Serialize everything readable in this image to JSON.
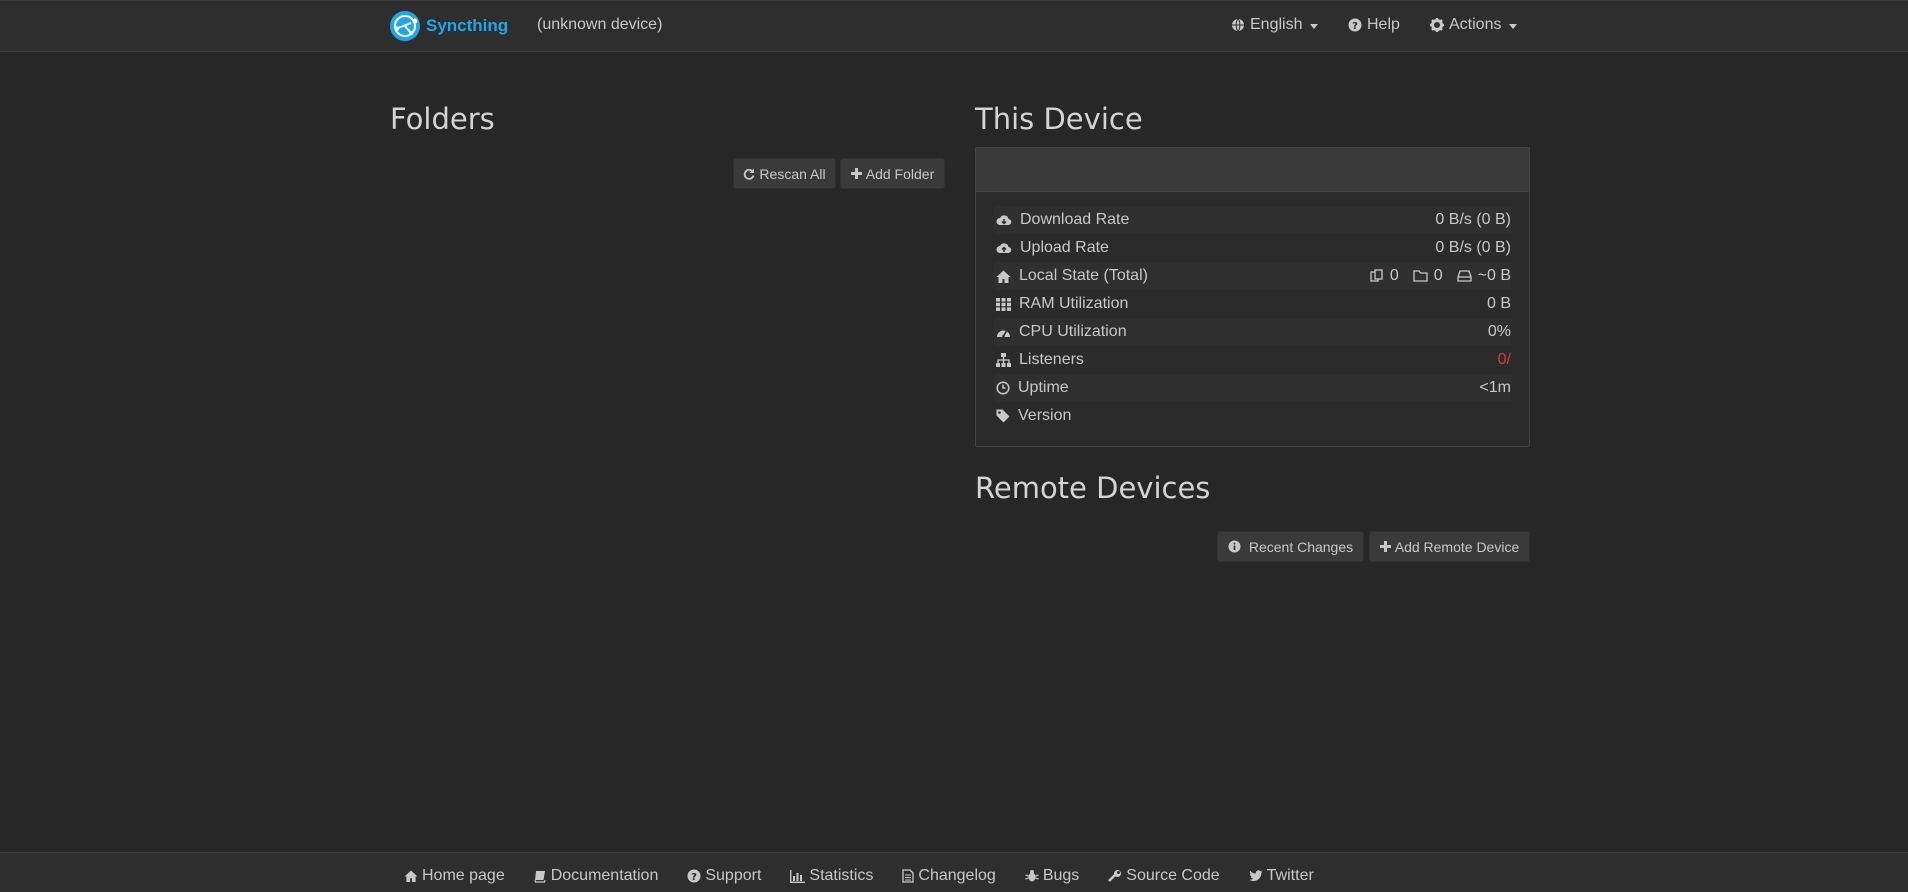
{
  "navbar": {
    "brand": "Syncthing",
    "device_name": "(unknown device)",
    "language": "English",
    "help": "Help",
    "actions": "Actions"
  },
  "folders": {
    "title": "Folders",
    "rescan_all": "Rescan All",
    "add_folder": "Add Folder"
  },
  "this_device": {
    "title": "This Device",
    "rows": {
      "download": {
        "label": "Download Rate",
        "value": "0 B/s (0 B)"
      },
      "upload": {
        "label": "Upload Rate",
        "value": "0 B/s (0 B)"
      },
      "local_state": {
        "label": "Local State (Total)",
        "files": "0",
        "dirs": "0",
        "size": "~0 B"
      },
      "ram": {
        "label": "RAM Utilization",
        "value": "0 B"
      },
      "cpu": {
        "label": "CPU Utilization",
        "value": "0%"
      },
      "listeners": {
        "label": "Listeners",
        "value": "0/"
      },
      "uptime": {
        "label": "Uptime",
        "value": "<1m"
      },
      "version": {
        "label": "Version",
        "value": ""
      }
    }
  },
  "remote_devices": {
    "title": "Remote Devices",
    "recent_changes": "Recent Changes",
    "add_remote_device": "Add Remote Device"
  },
  "footer": {
    "links": [
      "Home page",
      "Documentation",
      "Support",
      "Statistics",
      "Changelog",
      "Bugs",
      "Source Code",
      "Twitter"
    ]
  },
  "colors": {
    "background": "#272727",
    "brand": "#22a6e8",
    "listeners_red": "#d9383a"
  }
}
